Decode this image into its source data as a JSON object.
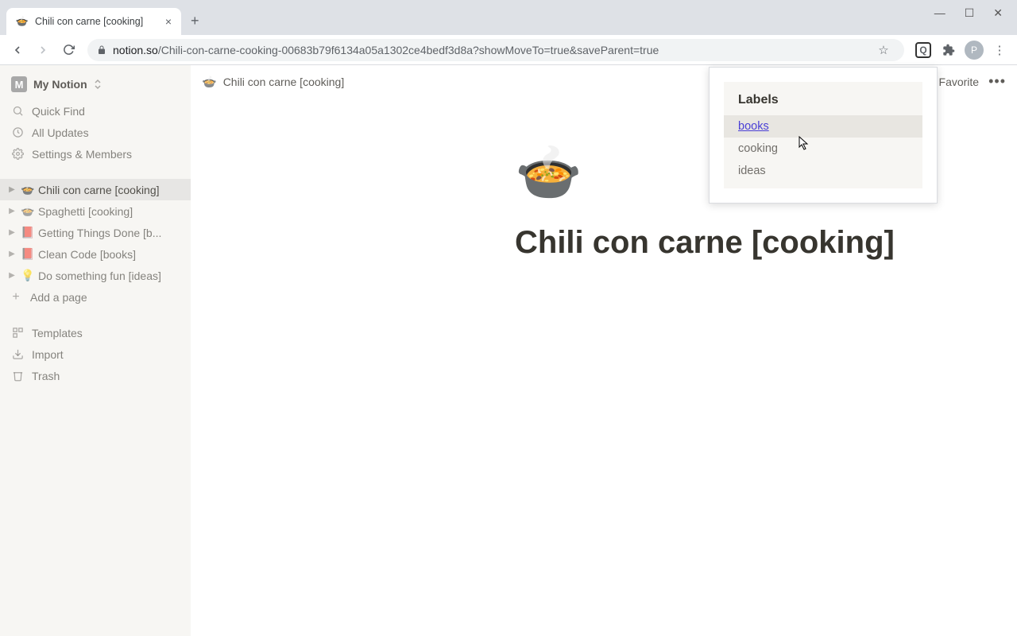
{
  "browser": {
    "tab_title": "Chili con carne [cooking]",
    "new_tab": "+",
    "close": "×",
    "url_domain": "notion.so",
    "url_path": "/Chili-con-carne-cooking-00683b79f6134a05a1302ce4bedf3d8a?showMoveTo=true&saveParent=true",
    "star": "☆",
    "ext_glyph": "Q",
    "menu": "⋮",
    "avatar": "P",
    "min": "—",
    "max": "☐",
    "closewin": "✕"
  },
  "sidebar": {
    "workspace_letter": "M",
    "workspace_name": "My Notion",
    "quick_find": "Quick Find",
    "all_updates": "All Updates",
    "settings": "Settings & Members",
    "pages": [
      {
        "emoji": "🍲",
        "label": "Chili con carne [cooking]",
        "active": true
      },
      {
        "emoji": "🍲",
        "label": "Spaghetti [cooking]",
        "active": false
      },
      {
        "emoji": "📕",
        "label": "Getting Things Done [b...",
        "active": false
      },
      {
        "emoji": "📕",
        "label": "Clean Code [books]",
        "active": false
      },
      {
        "emoji": "💡",
        "label": "Do something fun [ideas]",
        "active": false
      }
    ],
    "add_page": "Add a page",
    "templates": "Templates",
    "import": "Import",
    "trash": "Trash"
  },
  "topbar": {
    "breadcrumb_emoji": "🍲",
    "breadcrumb_label": "Chili con carne [cooking]",
    "favorite": "Favorite"
  },
  "content": {
    "hero_emoji": "🍲",
    "title": "Chili con carne [cooking]"
  },
  "popup": {
    "title": "Labels",
    "items": [
      "books",
      "cooking",
      "ideas"
    ],
    "selected_index": 0
  }
}
